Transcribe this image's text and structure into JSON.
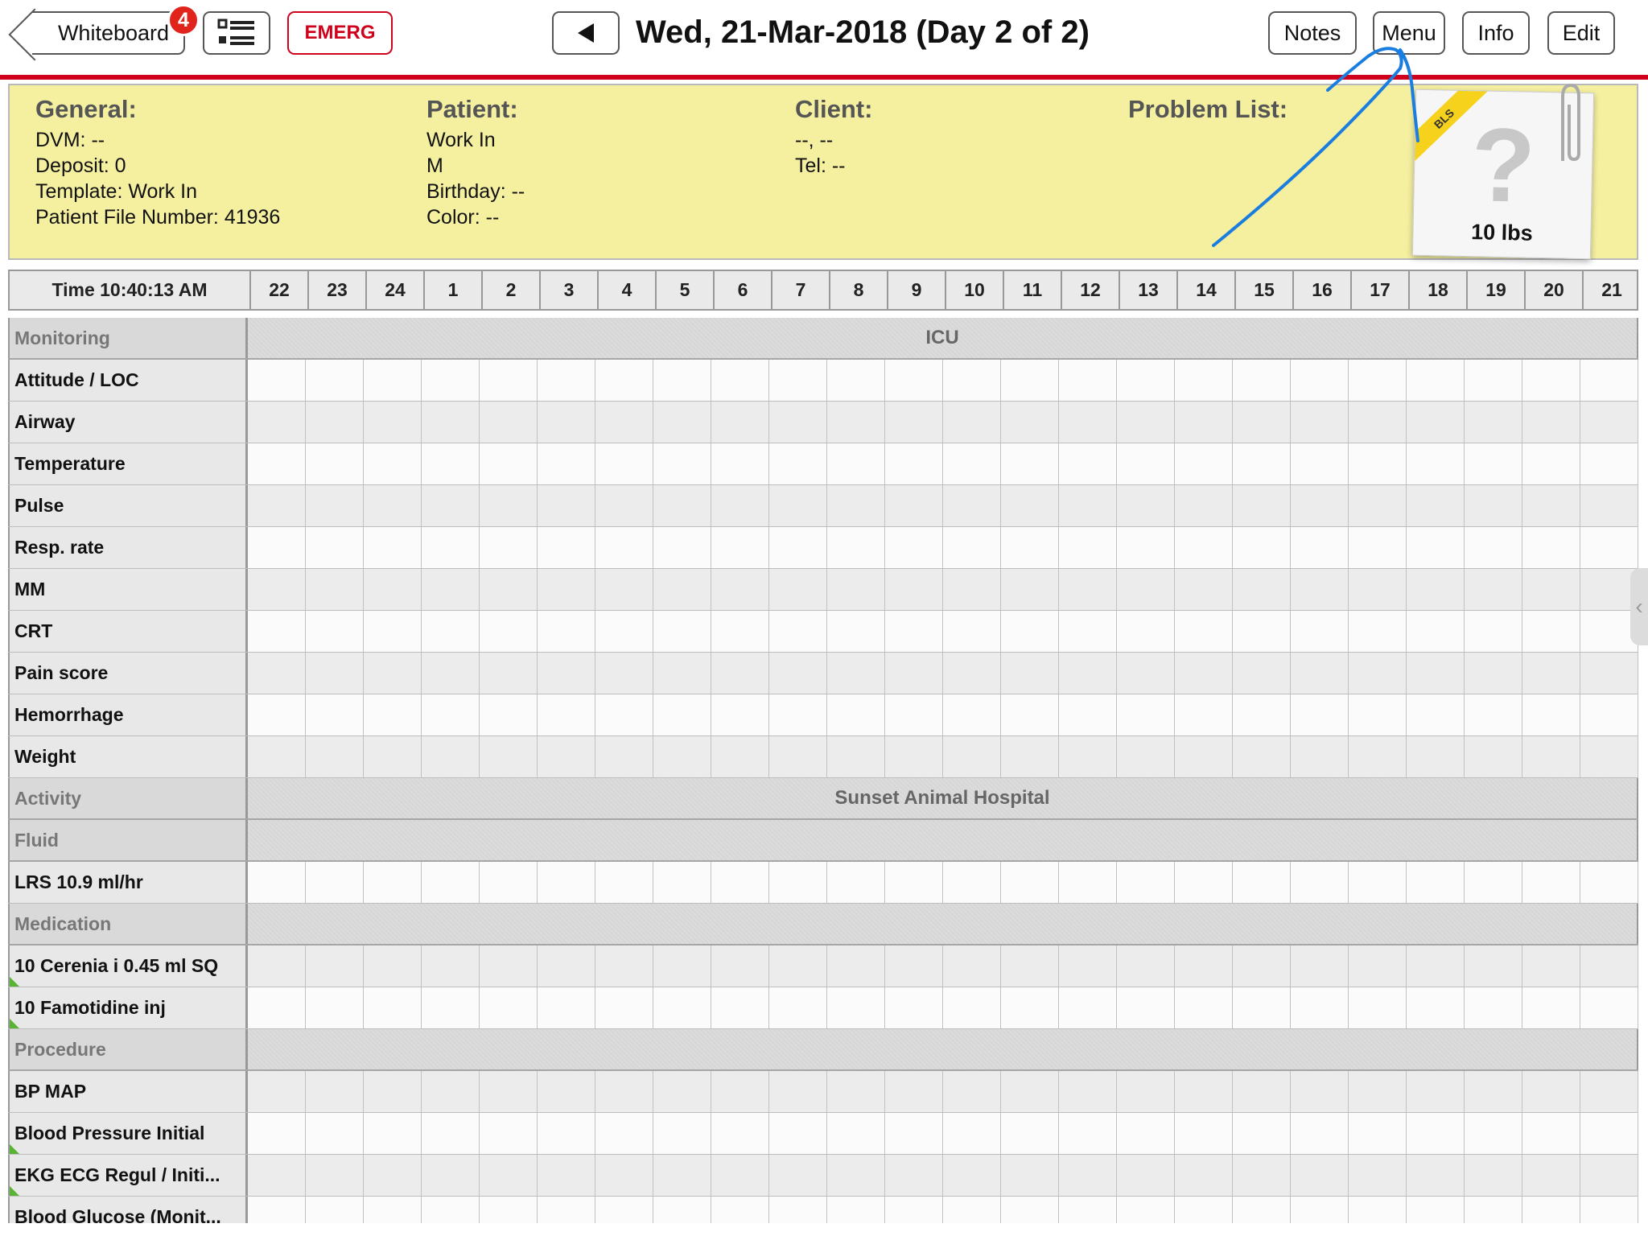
{
  "topbar": {
    "back_label": "Whiteboard",
    "badge_count": "4",
    "emerg_label": "EMERG",
    "date_title": "Wed, 21-Mar-2018 (Day 2 of 2)",
    "notes_label": "Notes",
    "menu_label": "Menu",
    "info_label": "Info",
    "edit_label": "Edit"
  },
  "info_panel": {
    "general": {
      "heading": "General:",
      "dvm": "DVM: --",
      "deposit": "Deposit: 0",
      "template": "Template: Work In",
      "file_number": "Patient File Number: 41936"
    },
    "patient": {
      "heading": "Patient:",
      "name": "Work In",
      "sex": "M",
      "birthday": "Birthday: --",
      "color": "Color: --"
    },
    "client": {
      "heading": "Client:",
      "name": "--, --",
      "tel": "Tel: --"
    },
    "problem_list": {
      "heading": "Problem List:"
    },
    "photo": {
      "ribbon": "BLS",
      "weight": "10 lbs"
    }
  },
  "grid": {
    "time_label": "Time 10:40:13 AM",
    "hours": [
      "22",
      "23",
      "24",
      "1",
      "2",
      "3",
      "4",
      "5",
      "6",
      "7",
      "8",
      "9",
      "10",
      "11",
      "12",
      "13",
      "14",
      "15",
      "16",
      "17",
      "18",
      "19",
      "20",
      "21"
    ],
    "rows": [
      {
        "type": "section",
        "label": "Monitoring",
        "band": "ICU"
      },
      {
        "type": "item",
        "label": "Attitude / LOC"
      },
      {
        "type": "item",
        "label": "Airway"
      },
      {
        "type": "item",
        "label": "Temperature"
      },
      {
        "type": "item",
        "label": "Pulse"
      },
      {
        "type": "item",
        "label": "Resp. rate"
      },
      {
        "type": "item",
        "label": "MM"
      },
      {
        "type": "item",
        "label": "CRT"
      },
      {
        "type": "item",
        "label": "Pain score"
      },
      {
        "type": "item",
        "label": "Hemorrhage"
      },
      {
        "type": "item",
        "label": "Weight"
      },
      {
        "type": "section",
        "label": "Activity",
        "band": "Sunset Animal Hospital"
      },
      {
        "type": "section",
        "label": "Fluid",
        "band": ""
      },
      {
        "type": "item",
        "label": "LRS 10.9 ml/hr"
      },
      {
        "type": "section",
        "label": "Medication",
        "band": ""
      },
      {
        "type": "item",
        "label": "10 Cerenia i 0.45 ml SQ",
        "flag": true
      },
      {
        "type": "item",
        "label": "10 Famotidine inj",
        "flag": true
      },
      {
        "type": "section",
        "label": "Procedure",
        "band": ""
      },
      {
        "type": "item",
        "label": "BP MAP"
      },
      {
        "type": "item",
        "label": "Blood Pressure Initial",
        "flag": true
      },
      {
        "type": "item",
        "label": "EKG ECG Regul / Initi...",
        "flag": true
      },
      {
        "type": "item",
        "label": "Blood Glucose (Monit..."
      }
    ]
  },
  "colors": {
    "accent_red": "#d0021b",
    "panel_yellow": "#f5f0a0",
    "annotation_blue": "#1a7de0",
    "flag_green": "#58b432"
  }
}
